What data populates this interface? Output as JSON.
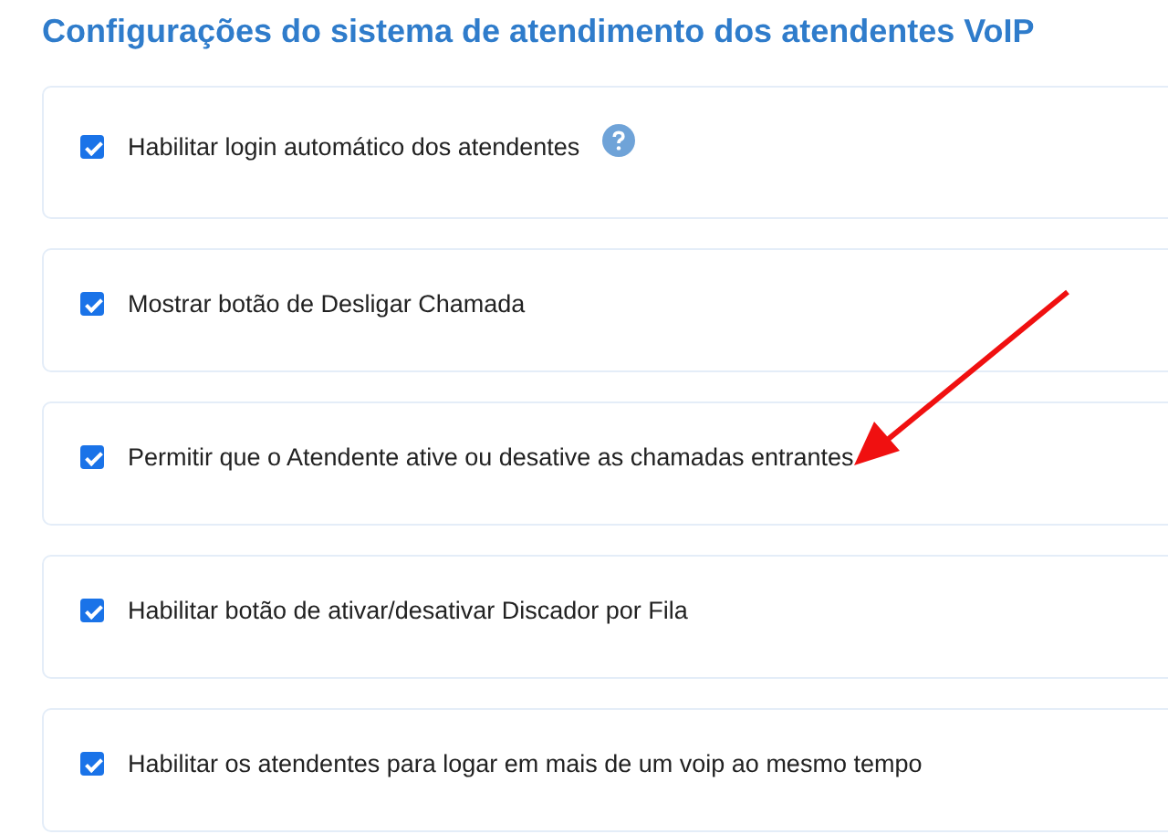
{
  "title": "Configurações do sistema de atendimento dos atendentes VoIP",
  "options": [
    {
      "label": "Habilitar login automático dos atendentes",
      "checked": true,
      "help": true,
      "highlighted": false
    },
    {
      "label": "Mostrar botão de Desligar Chamada",
      "checked": true,
      "help": false,
      "highlighted": false
    },
    {
      "label": "Permitir que o Atendente ative ou desative as chamadas entrantes",
      "checked": true,
      "help": false,
      "highlighted": true
    },
    {
      "label": "Habilitar botão de ativar/desativar Discador por Fila",
      "checked": true,
      "help": false,
      "highlighted": false
    },
    {
      "label": "Habilitar os atendentes para logar em mais de um voip ao mesmo tempo",
      "checked": true,
      "help": false,
      "highlighted": false
    }
  ]
}
